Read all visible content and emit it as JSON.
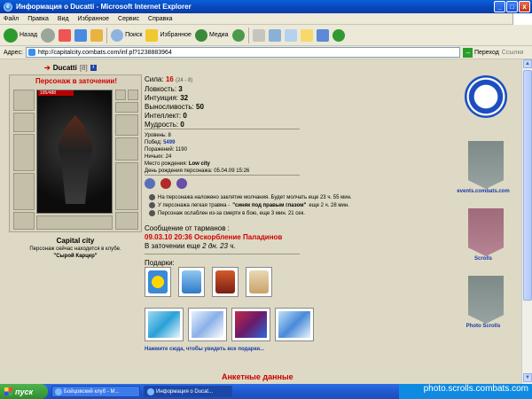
{
  "window": {
    "title": "Информация о Ducatti - Microsoft Internet Explorer",
    "min": "_",
    "max": "□",
    "close": "x"
  },
  "menu": [
    "Файл",
    "Правка",
    "Вид",
    "Избранное",
    "Сервис",
    "Справка"
  ],
  "toolbar": {
    "back": "Назад",
    "search": "Поиск",
    "favorites": "Избранное",
    "media": "Медиа"
  },
  "address": {
    "label": "Адрес:",
    "url": "http://capitalcity.combats.com/inf.pl?1238883964",
    "go": "Переход",
    "links": "Ссылки"
  },
  "character": {
    "name": "Ducatti",
    "level": "[8]",
    "info_badge": "i",
    "status": "Персонаж в заточении!",
    "hp": "195/488",
    "city": "Capital city",
    "club_text": "Персонаж сейчас находится в клубе.",
    "club_name": "\"Сырой Карцер\""
  },
  "stats": {
    "strength_label": "Сила:",
    "strength": "16",
    "strength_sub": "(24 - 8)",
    "agility_label": "Ловкость:",
    "agility": "3",
    "intuition_label": "Интуиция:",
    "intuition": "32",
    "endurance_label": "Выносливость:",
    "endurance": "50",
    "intellect_label": "Интеллект:",
    "intellect": "0",
    "wisdom_label": "Мудрость:",
    "wisdom": "0"
  },
  "details": {
    "level_label": "Уровень:",
    "level": "8",
    "wins_label": "Побед:",
    "wins": "5499",
    "losses_label": "Поражений:",
    "losses": "1190",
    "draws_label": "Ничьих:",
    "draws": "24",
    "birthplace_label": "Место рождения:",
    "birthplace": "Low city",
    "birthday_label": "День рождения персонажа:",
    "birthday": "05.04.09 15:26"
  },
  "effects": [
    {
      "pre": "На персонажа наложено заклятие молчания. Будет молчать еще 23 ч. 55 мин.",
      "bold": "",
      "post": ""
    },
    {
      "pre": "У персонажа легкая травма - ",
      "bold": "\"синяк под правым глазом\"",
      "post": " еще 2 ч. 28 мин."
    },
    {
      "pre": "Персонаж ослаблен из-за смерти в бою, еще 3 мин. 21 сек.",
      "bold": "",
      "post": ""
    }
  ],
  "message": {
    "heading": "Сообщение от тарманов :",
    "text": "09.03.10 20:36 Оскорбление Паладинов",
    "prison_pre": "В заточении еще ",
    "prison_time": "2 дн. 23 ч."
  },
  "gifts": {
    "heading": "Подарки:",
    "more_link": "Нажмите сюда, чтобы увидеть все подарки..."
  },
  "anketa": "Анкетные данные",
  "right_panel": {
    "events": "events.combats.com",
    "scrolls": "Scrolls",
    "photo": "Photo Scrolls"
  },
  "taskbar": {
    "start": "пуск",
    "task1": "Бойцовский клуб - М...",
    "task2": "Информация о Ducat...",
    "watermark": "photo.scrolls.combats.com"
  }
}
